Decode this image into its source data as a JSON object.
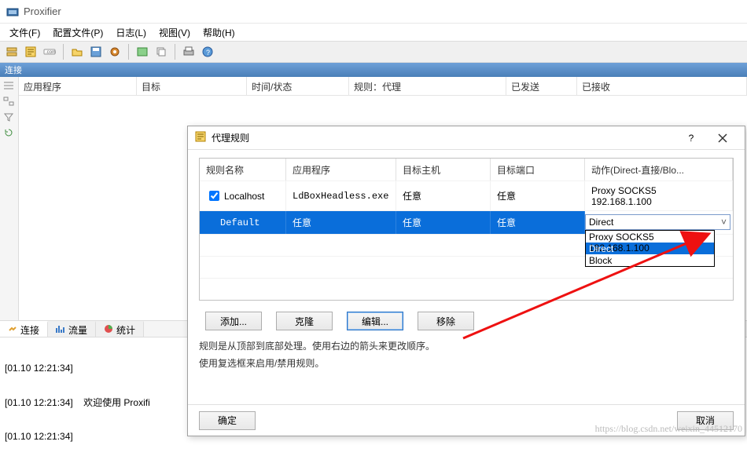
{
  "app": {
    "title": "Proxifier"
  },
  "menu": {
    "file": "文件(F)",
    "profile": "配置文件(P)",
    "log": "日志(L)",
    "view": "视图(V)",
    "help": "帮助(H)"
  },
  "connections_bar": "连接",
  "grid_columns": {
    "app": "应用程序",
    "target": "目标",
    "time": "时间/状态",
    "rule": "规则：代理",
    "sent": "已发送",
    "recv": "已接收"
  },
  "tabs": {
    "connections": "连接",
    "traffic": "流量",
    "stats": "统计"
  },
  "log_lines": [
    "[01.10 12:21:34]",
    "[01.10 12:21:34]    欢迎使用 Proxifi",
    "[01.10 12:21:34]"
  ],
  "dialog": {
    "title": "代理规则",
    "columns": {
      "name": "规则名称",
      "app": "应用程序",
      "host": "目标主机",
      "port": "目标端口",
      "action": "动作(Direct-直接/Blo..."
    },
    "rows": [
      {
        "checked": true,
        "name": "Localhost",
        "app": "LdBoxHeadless.exe",
        "host": "任意",
        "port": "任意",
        "action_line1": "Proxy SOCKS5",
        "action_line2": "192.168.1.100"
      },
      {
        "selected": true,
        "name": "Default",
        "app": "任意",
        "host": "任意",
        "port": "任意",
        "action": "Direct"
      }
    ],
    "dropdown": {
      "value": "Direct",
      "options": [
        "Proxy SOCKS5 192.168.1.100",
        "Direct",
        "Block"
      ],
      "highlight_index": 1
    },
    "buttons": {
      "add": "添加...",
      "clone": "克隆",
      "edit": "编辑...",
      "remove": "移除"
    },
    "hint1": "规则是从顶部到底部处理。使用右边的箭头来更改顺序。",
    "hint2": "使用复选框来启用/禁用规则。",
    "ok": "确定",
    "cancel": "取消"
  },
  "watermark": "https://blog.csdn.net/weixin_44512170"
}
